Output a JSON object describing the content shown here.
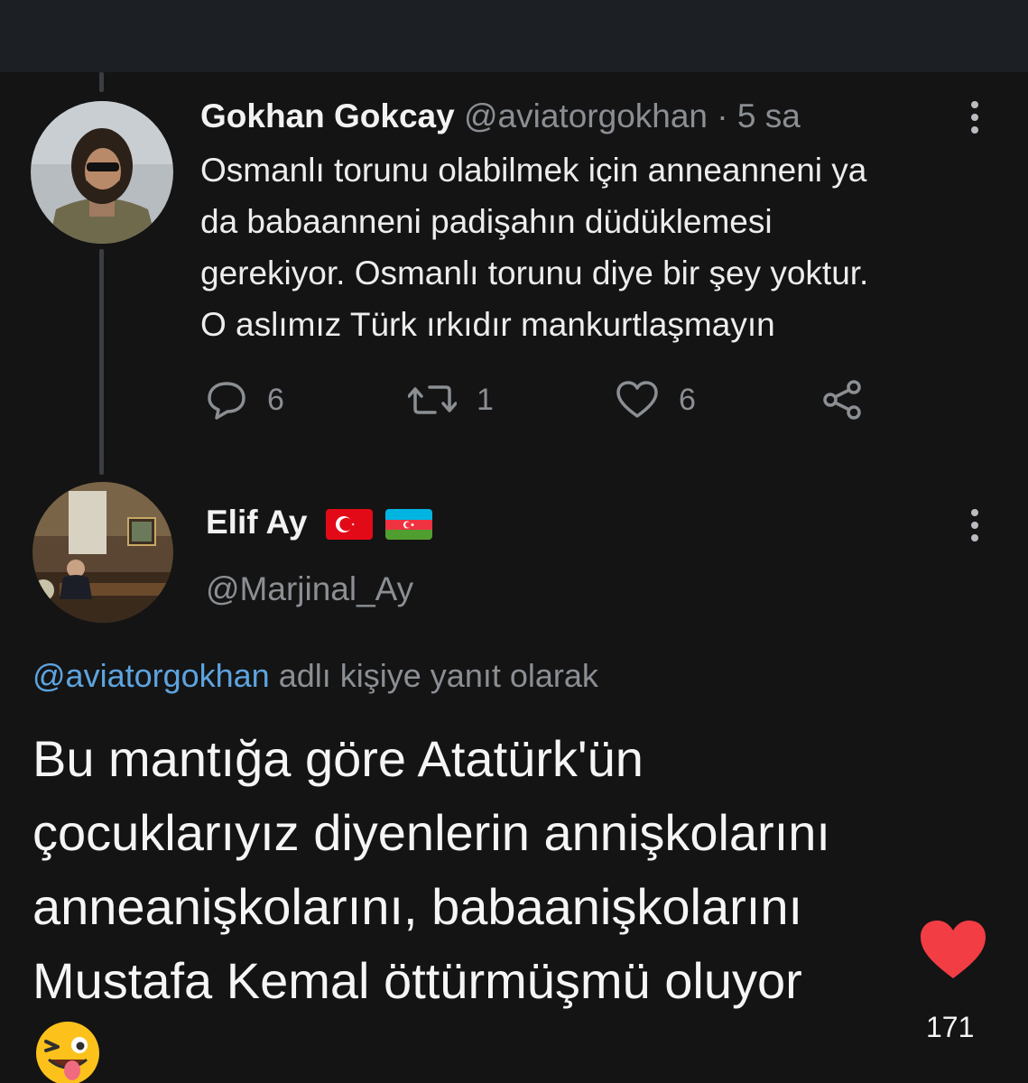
{
  "tweet": {
    "author_name": "Gokhan Gokcay",
    "handle": "@aviatorgokhan",
    "separator": "·",
    "time": "5 sa",
    "lines": [
      "Osmanlı torunu olabilmek için anneanneni ya",
      "da babaanneni padişahın düdüklemesi",
      "gerekiyor. Osmanlı torunu diye bir şey yoktur.",
      "O aslımız Türk ırkıdır mankurtlaşmayın"
    ],
    "reply_count": "6",
    "retweet_count": "1",
    "like_count": "6"
  },
  "reply": {
    "author_name": "Elif Ay",
    "flags": [
      "turkey-flag",
      "azerbaijan-flag"
    ],
    "handle": "@Marjinal_Ay",
    "reply_to_handle": "@aviatorgokhan",
    "reply_to_suffix": "adlı kişiye yanıt olarak",
    "lines": [
      "Bu mantığa göre Atatürk'ün",
      "çocuklarıyız diyenlerin annişkolarını",
      "anneanişkolarını, babaanişkolarını",
      "Mustafa Kemal öttürmüşmü oluyor"
    ],
    "emoji": "zany-face-emoji"
  },
  "overlay": {
    "like_count": "171",
    "heart_color": "#f23d45"
  },
  "colors": {
    "background": "#141414",
    "topbar": "#1c1f24",
    "muted": "#8b8f94",
    "link": "#5da4e0"
  }
}
